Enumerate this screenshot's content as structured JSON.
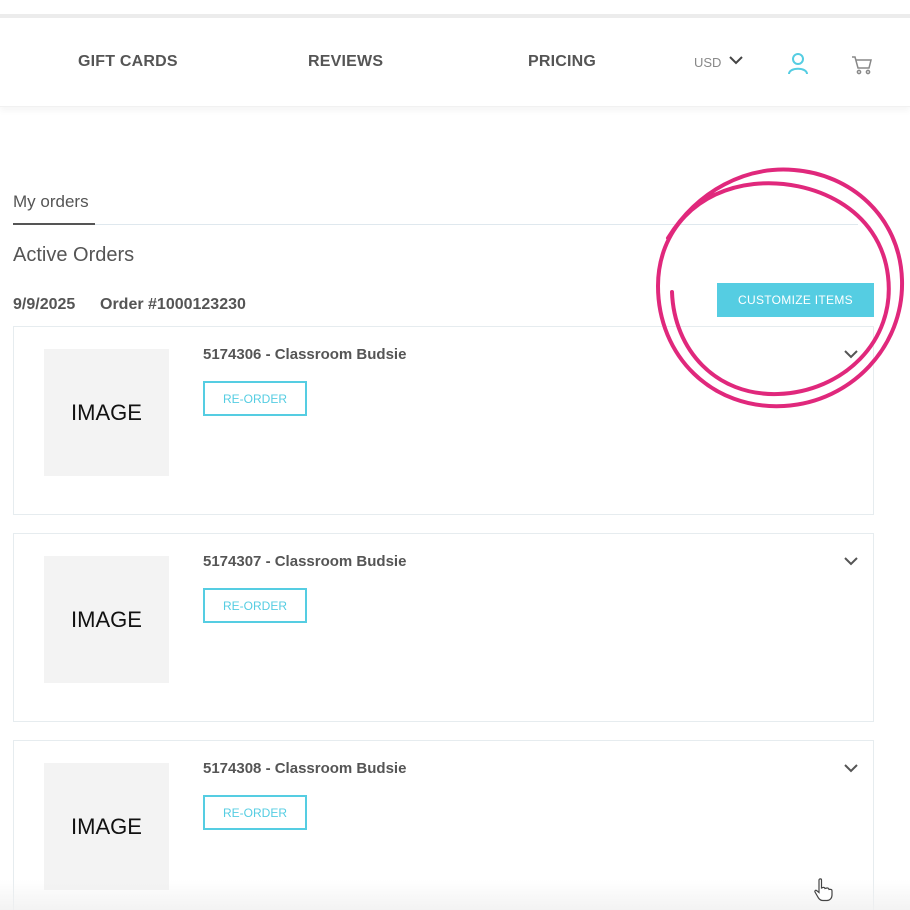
{
  "nav": {
    "links": [
      "GIFT CARDS",
      "REVIEWS",
      "PRICING"
    ],
    "currency": "USD"
  },
  "account": {
    "tab_label": "My orders",
    "section_title": "Active Orders"
  },
  "order": {
    "date": "9/9/2025",
    "number": "Order #1000123230",
    "customize_label": "CUSTOMIZE ITEMS",
    "items": [
      {
        "title": "5174306 - Classroom Budsie",
        "image_label": "IMAGE",
        "reorder_label": "RE-ORDER"
      },
      {
        "title": "5174307 - Classroom Budsie",
        "image_label": "IMAGE",
        "reorder_label": "RE-ORDER"
      },
      {
        "title": "5174308 - Classroom Budsie",
        "image_label": "IMAGE",
        "reorder_label": "RE-ORDER"
      }
    ]
  },
  "icons": {
    "user": "user-icon",
    "cart": "cart-icon",
    "currency_chevron": "chevron-down-icon",
    "item_chevron": "chevron-down-icon",
    "pointer": "hand-pointer-icon"
  },
  "colors": {
    "accent": "#55cde2",
    "annotation": "#e0287c",
    "text": "#555555",
    "image_placeholder": "#f3f3f3"
  }
}
